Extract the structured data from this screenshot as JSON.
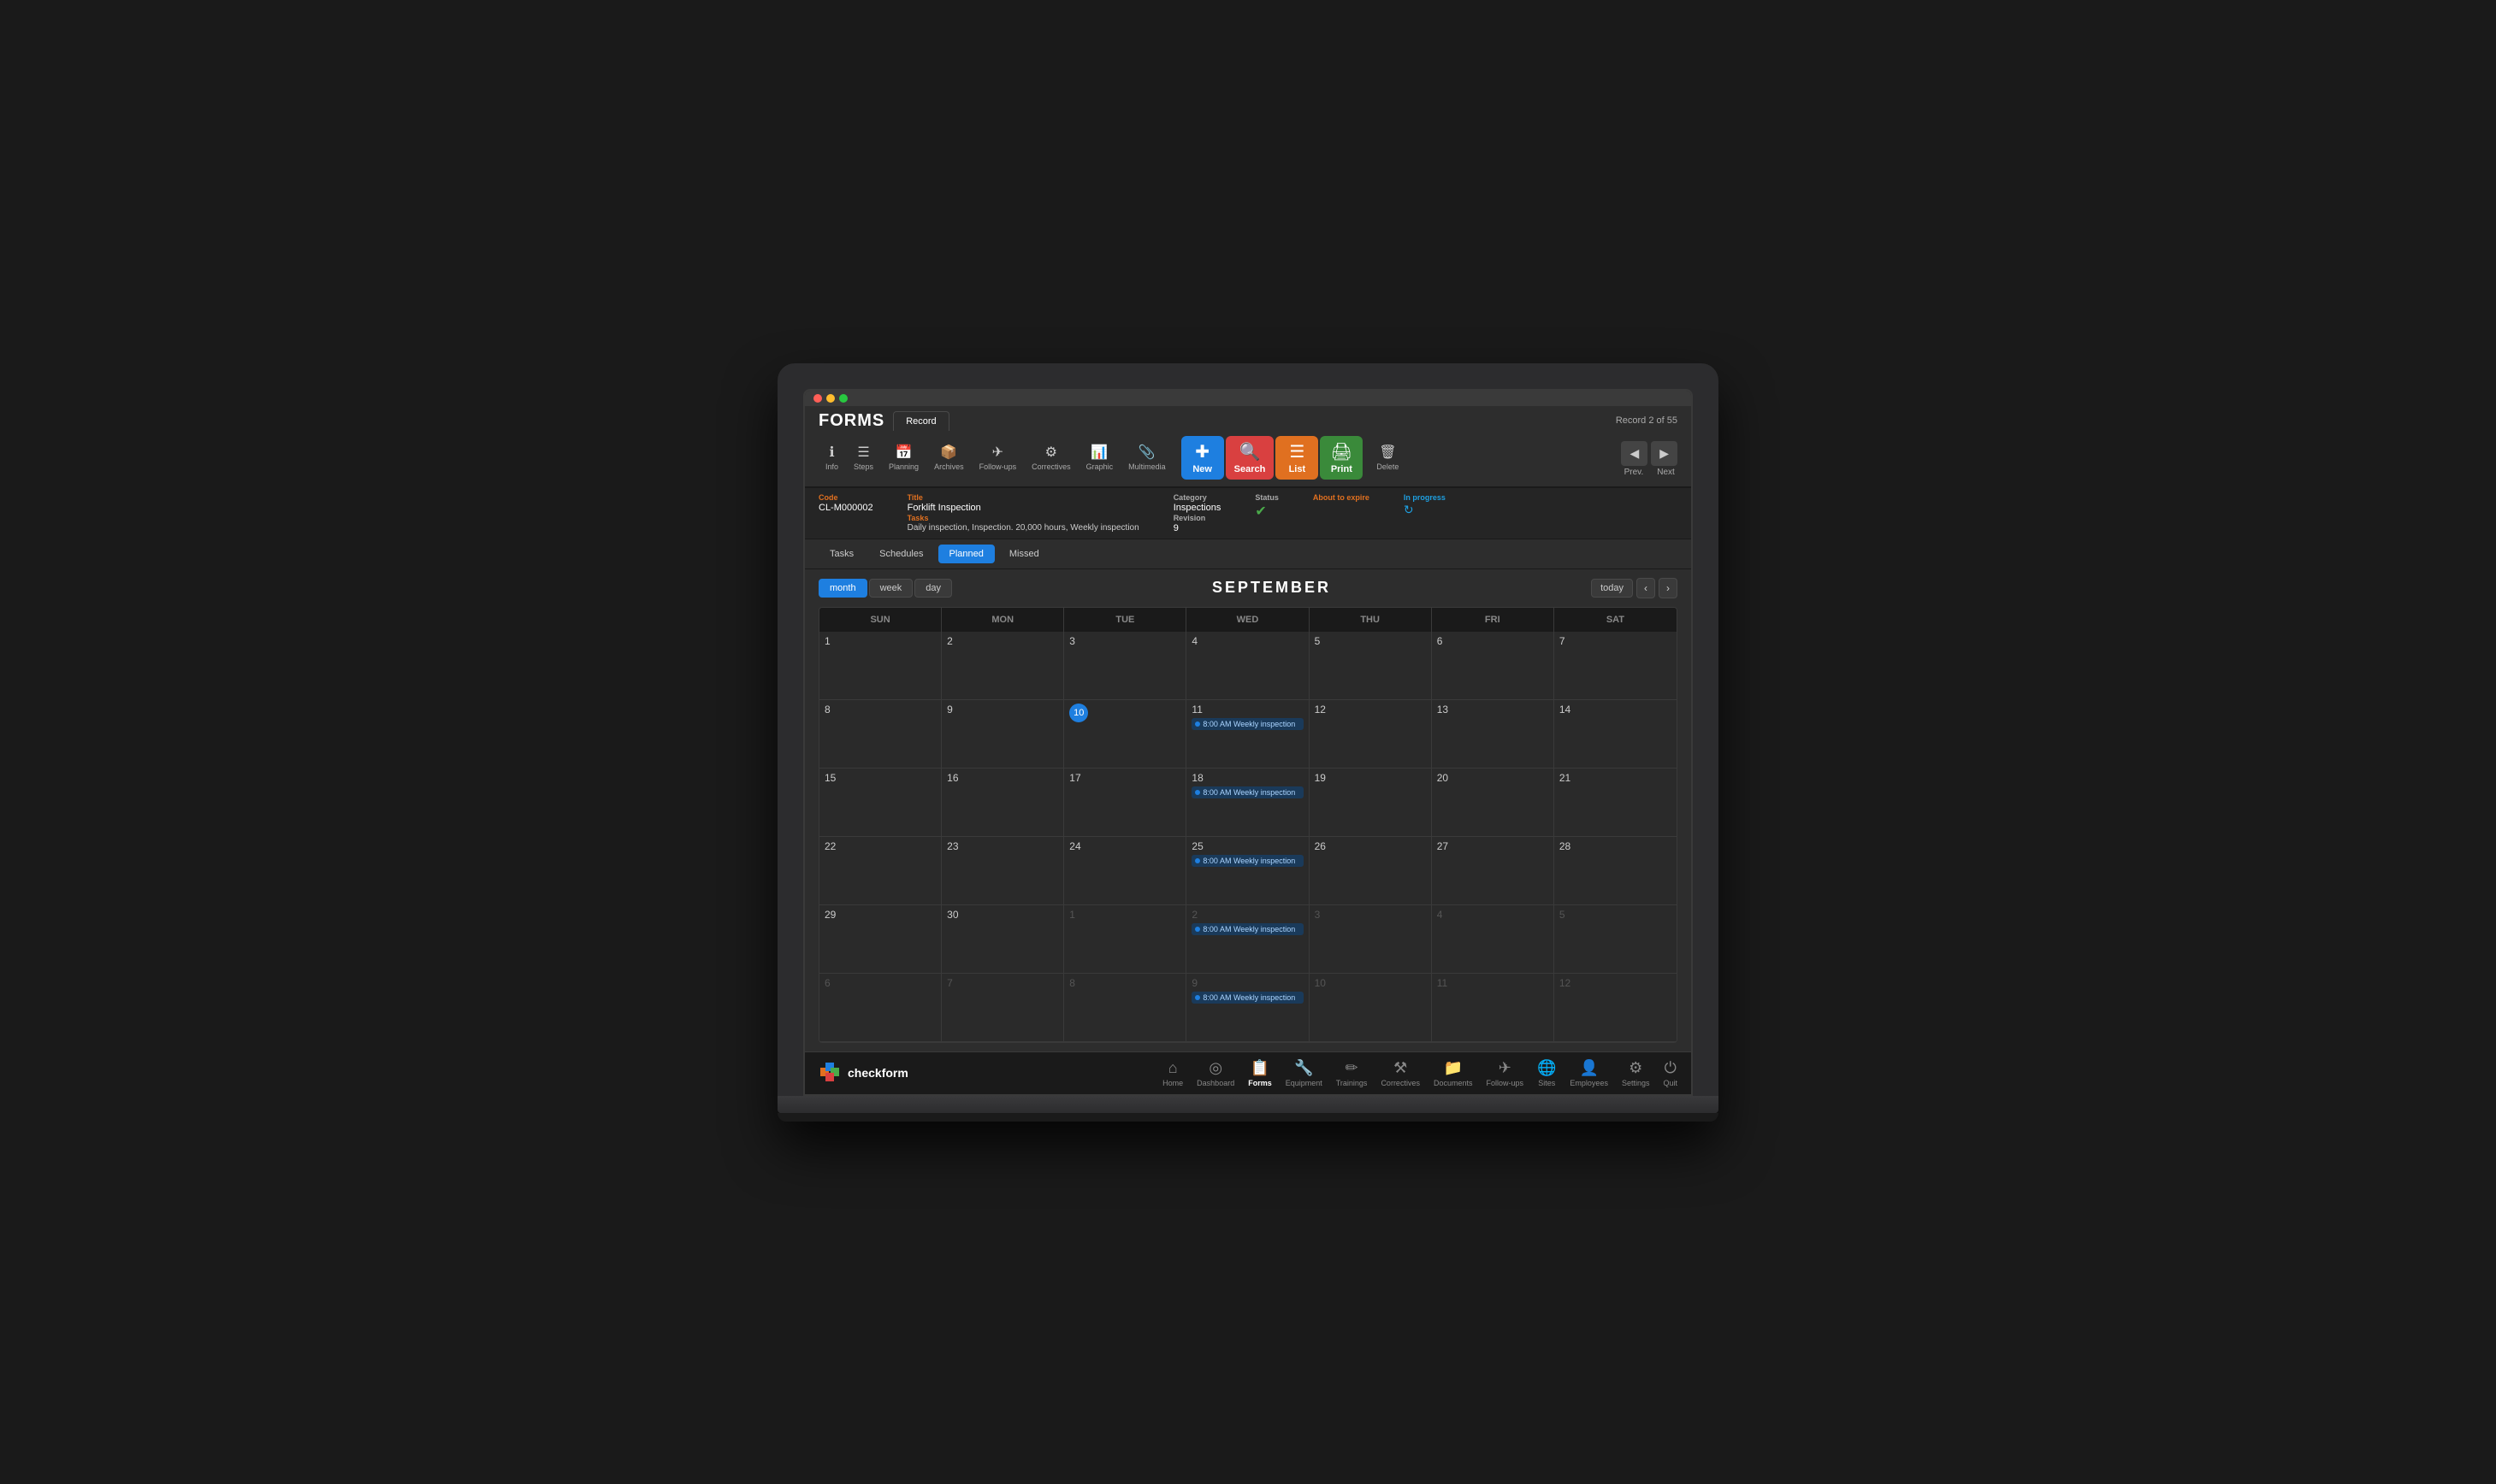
{
  "app": {
    "title": "FORMS",
    "record_info": "Record 2 of 55"
  },
  "toolbar": {
    "new_label": "New",
    "search_label": "Search",
    "list_label": "List",
    "print_label": "Print",
    "delete_label": "Delete",
    "prev_label": "Prev.",
    "next_label": "Next",
    "info_label": "Info",
    "steps_label": "Steps",
    "planning_label": "Planning",
    "archives_label": "Archives",
    "follow_ups_label": "Follow-ups",
    "correctives_label": "Correctives",
    "graphic_label": "Graphic",
    "multimedia_label": "Multimedia"
  },
  "record": {
    "code_label": "Code",
    "code_value": "CL-M000002",
    "title_label": "Title",
    "title_value": "Forklift Inspection",
    "tasks_label": "Tasks",
    "tasks_value": "Daily inspection, Inspection. 20,000 hours, Weekly inspection",
    "category_label": "Category",
    "category_value": "Inspections",
    "status_label": "Status",
    "about_to_expire_label": "About to expire",
    "revision_label": "Revision",
    "revision_value": "9",
    "in_progress_label": "In progress"
  },
  "tabs": {
    "items": [
      {
        "label": "Tasks",
        "active": false
      },
      {
        "label": "Schedules",
        "active": false
      },
      {
        "label": "Planned",
        "active": true
      },
      {
        "label": "Missed",
        "active": false
      }
    ]
  },
  "calendar": {
    "view_buttons": [
      "month",
      "week",
      "day"
    ],
    "active_view": "month",
    "month_title": "SEPTEMBER",
    "today_label": "today",
    "days_header": [
      "SUN",
      "MON",
      "TUE",
      "WED",
      "THU",
      "FRI",
      "SAT"
    ],
    "today_date": 10,
    "event_text": "8:00 AM Weekly inspection",
    "weeks": [
      [
        {
          "day": 1,
          "other": false,
          "events": []
        },
        {
          "day": 2,
          "other": false,
          "events": []
        },
        {
          "day": 3,
          "other": false,
          "events": []
        },
        {
          "day": 4,
          "other": false,
          "events": []
        },
        {
          "day": 5,
          "other": false,
          "events": []
        },
        {
          "day": 6,
          "other": false,
          "events": []
        },
        {
          "day": 7,
          "other": false,
          "events": []
        }
      ],
      [
        {
          "day": 8,
          "other": false,
          "events": []
        },
        {
          "day": 9,
          "other": false,
          "events": []
        },
        {
          "day": 10,
          "other": false,
          "today": true,
          "events": []
        },
        {
          "day": 11,
          "other": false,
          "events": [
            "8:00 AM Weekly inspection"
          ]
        },
        {
          "day": 12,
          "other": false,
          "events": []
        },
        {
          "day": 13,
          "other": false,
          "events": []
        },
        {
          "day": 14,
          "other": false,
          "events": []
        }
      ],
      [
        {
          "day": 15,
          "other": false,
          "events": []
        },
        {
          "day": 16,
          "other": false,
          "events": []
        },
        {
          "day": 17,
          "other": false,
          "events": []
        },
        {
          "day": 18,
          "other": false,
          "events": [
            "8:00 AM Weekly inspection"
          ]
        },
        {
          "day": 19,
          "other": false,
          "events": []
        },
        {
          "day": 20,
          "other": false,
          "events": []
        },
        {
          "day": 21,
          "other": false,
          "events": []
        }
      ],
      [
        {
          "day": 22,
          "other": false,
          "events": []
        },
        {
          "day": 23,
          "other": false,
          "events": []
        },
        {
          "day": 24,
          "other": false,
          "events": []
        },
        {
          "day": 25,
          "other": false,
          "events": [
            "8:00 AM Weekly inspection"
          ]
        },
        {
          "day": 26,
          "other": false,
          "events": []
        },
        {
          "day": 27,
          "other": false,
          "events": []
        },
        {
          "day": 28,
          "other": false,
          "events": []
        }
      ],
      [
        {
          "day": 29,
          "other": false,
          "events": []
        },
        {
          "day": 30,
          "other": false,
          "events": []
        },
        {
          "day": 1,
          "other": true,
          "events": []
        },
        {
          "day": 2,
          "other": true,
          "events": [
            "8:00 AM Weekly inspection"
          ]
        },
        {
          "day": 3,
          "other": true,
          "events": []
        },
        {
          "day": 4,
          "other": true,
          "events": []
        },
        {
          "day": 5,
          "other": true,
          "events": []
        }
      ],
      [
        {
          "day": 6,
          "other": true,
          "events": []
        },
        {
          "day": 7,
          "other": true,
          "events": []
        },
        {
          "day": 8,
          "other": true,
          "events": []
        },
        {
          "day": 9,
          "other": true,
          "events": [
            "8:00 AM Weekly inspection"
          ]
        },
        {
          "day": 10,
          "other": true,
          "events": []
        },
        {
          "day": 11,
          "other": true,
          "events": []
        },
        {
          "day": 12,
          "other": true,
          "events": []
        }
      ]
    ]
  },
  "bottom_nav": {
    "logo_text": "checkform",
    "items": [
      {
        "label": "Home",
        "icon": "🏠",
        "active": false
      },
      {
        "label": "Dashboard",
        "icon": "⊙",
        "active": false
      },
      {
        "label": "Forms",
        "icon": "📋",
        "active": true
      },
      {
        "label": "Equipment",
        "icon": "🔧",
        "active": false
      },
      {
        "label": "Trainings",
        "icon": "🔨",
        "active": false
      },
      {
        "label": "Correctives",
        "icon": "🔧",
        "active": false
      },
      {
        "label": "Documents",
        "icon": "📁",
        "active": false
      },
      {
        "label": "Follow-ups",
        "icon": "✈",
        "active": false
      },
      {
        "label": "Sites",
        "icon": "🌐",
        "active": false
      },
      {
        "label": "Employees",
        "icon": "👤",
        "active": false
      },
      {
        "label": "Settings",
        "icon": "⚙",
        "active": false
      },
      {
        "label": "Quit",
        "icon": "⏻",
        "active": false
      }
    ]
  }
}
